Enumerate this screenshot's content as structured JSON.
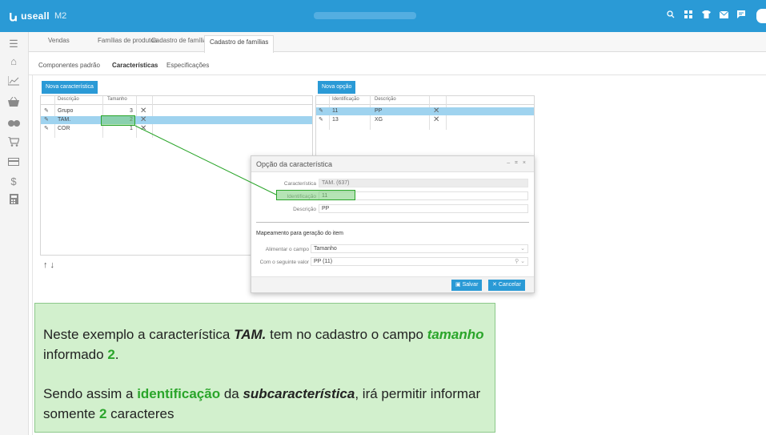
{
  "app": {
    "logo_text": "useall",
    "logo_sub": "M2",
    "icons": [
      "search-icon",
      "grid-icon",
      "shirt-icon",
      "mail-icon",
      "chat-icon"
    ],
    "accent": "#2a9ad6"
  },
  "sidebar": {
    "icons": [
      "menu-icon",
      "home-icon",
      "chart-icon",
      "basket-icon",
      "handshake-icon",
      "cart-icon",
      "card-icon",
      "dollar-icon",
      "calculator-icon"
    ]
  },
  "tabs": [
    "Vendas",
    "Famílias de produtos",
    "Cadastro de famílias",
    "Cadastro de famílias"
  ],
  "subtabs": [
    "Componentes padrão",
    "Características",
    "Especificações"
  ],
  "characteristics": {
    "button_label": "Nova característica",
    "headers": {
      "descricao": "Descrição",
      "tamanho": "Tamanho"
    },
    "rows": [
      {
        "descricao": "Grupo",
        "tamanho": "3"
      },
      {
        "descricao": "TAM.",
        "tamanho": "2"
      },
      {
        "descricao": "COR",
        "tamanho": "1"
      }
    ]
  },
  "options": {
    "button_label": "Nova opção",
    "headers": {
      "identificacao": "Identificação",
      "descricao": "Descrição"
    },
    "rows": [
      {
        "identificacao": "11",
        "descricao": "PP"
      },
      {
        "identificacao": "13",
        "descricao": "XG"
      }
    ]
  },
  "arrows": "↑↓",
  "dialog": {
    "title": "Opção da característica",
    "controls": "– ⌗ ×",
    "caracteristica_label": "Característica",
    "caracteristica_value": "TAM. (637)",
    "identificacao_label": "Identificação",
    "identificacao_value": "11",
    "descricao_label": "Descrição",
    "descricao_value": "PP",
    "section_title": "Mapeamento para geração do item",
    "alimentar_label": "Alimentar o campo",
    "alimentar_value": "Tamanho",
    "valor_label": "Com o seguinte valor",
    "valor_value": "PP (11)",
    "save_label": "Salvar",
    "cancel_label": "Cancelar"
  },
  "note": {
    "p1_a": "Neste exemplo a característica ",
    "p1_b": "TAM.",
    "p1_c": " tem no cadastro o campo ",
    "p1_d": "tamanho",
    "p1_e": " informado ",
    "p1_f": "2",
    "p1_g": ".",
    "p2_a": "Sendo assim a ",
    "p2_b": "identificação",
    "p2_c": " da ",
    "p2_d": "subcaracterística",
    "p2_e": ", irá permitir informar somente ",
    "p2_f": "2",
    "p2_g": " caracteres"
  }
}
